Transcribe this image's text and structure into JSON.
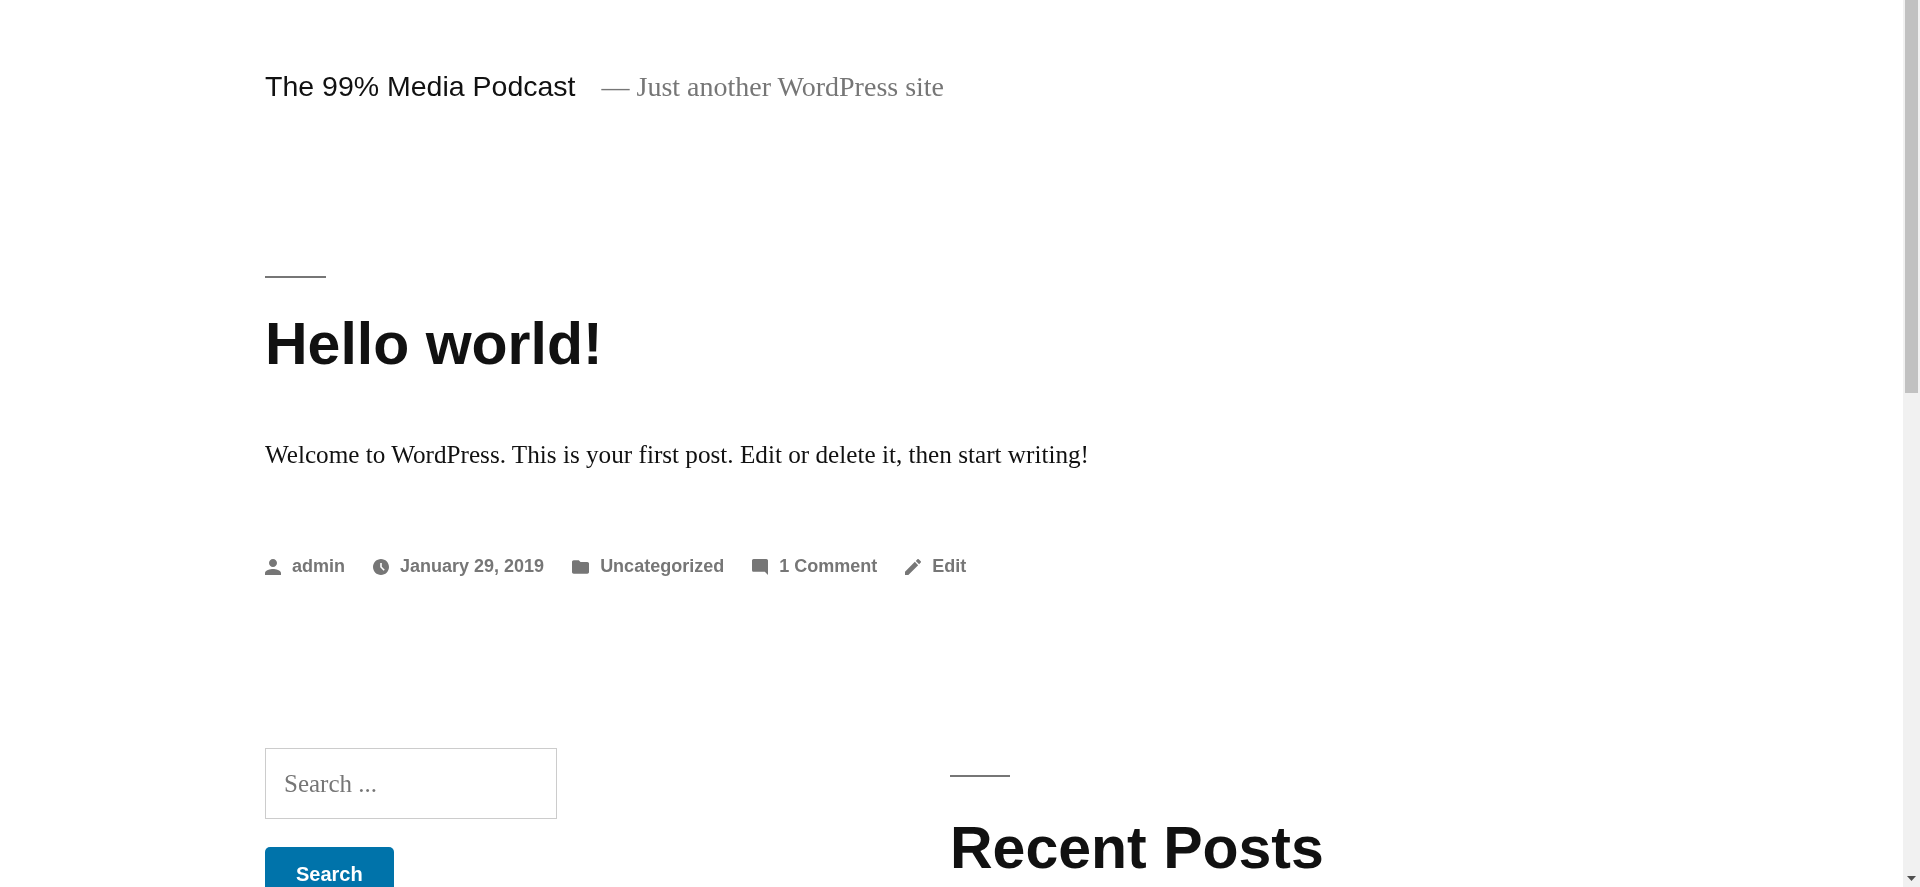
{
  "site": {
    "title": "The 99% Media Podcast",
    "tagline": "— Just another WordPress site"
  },
  "post": {
    "title": "Hello world!",
    "body": "Welcome to WordPress. This is your first post. Edit or delete it, then start writing!",
    "meta": [
      {
        "kind": "author",
        "text": "admin"
      },
      {
        "kind": "date",
        "text": "January 29, 2019"
      },
      {
        "kind": "category",
        "text": "Uncategorized"
      },
      {
        "kind": "comments",
        "text": "1 Comment"
      },
      {
        "kind": "edit",
        "text": "Edit"
      }
    ]
  },
  "widgets": {
    "search": {
      "placeholder": "Search ...",
      "button": "Search"
    },
    "recent_posts": {
      "title": "Recent Posts"
    }
  }
}
